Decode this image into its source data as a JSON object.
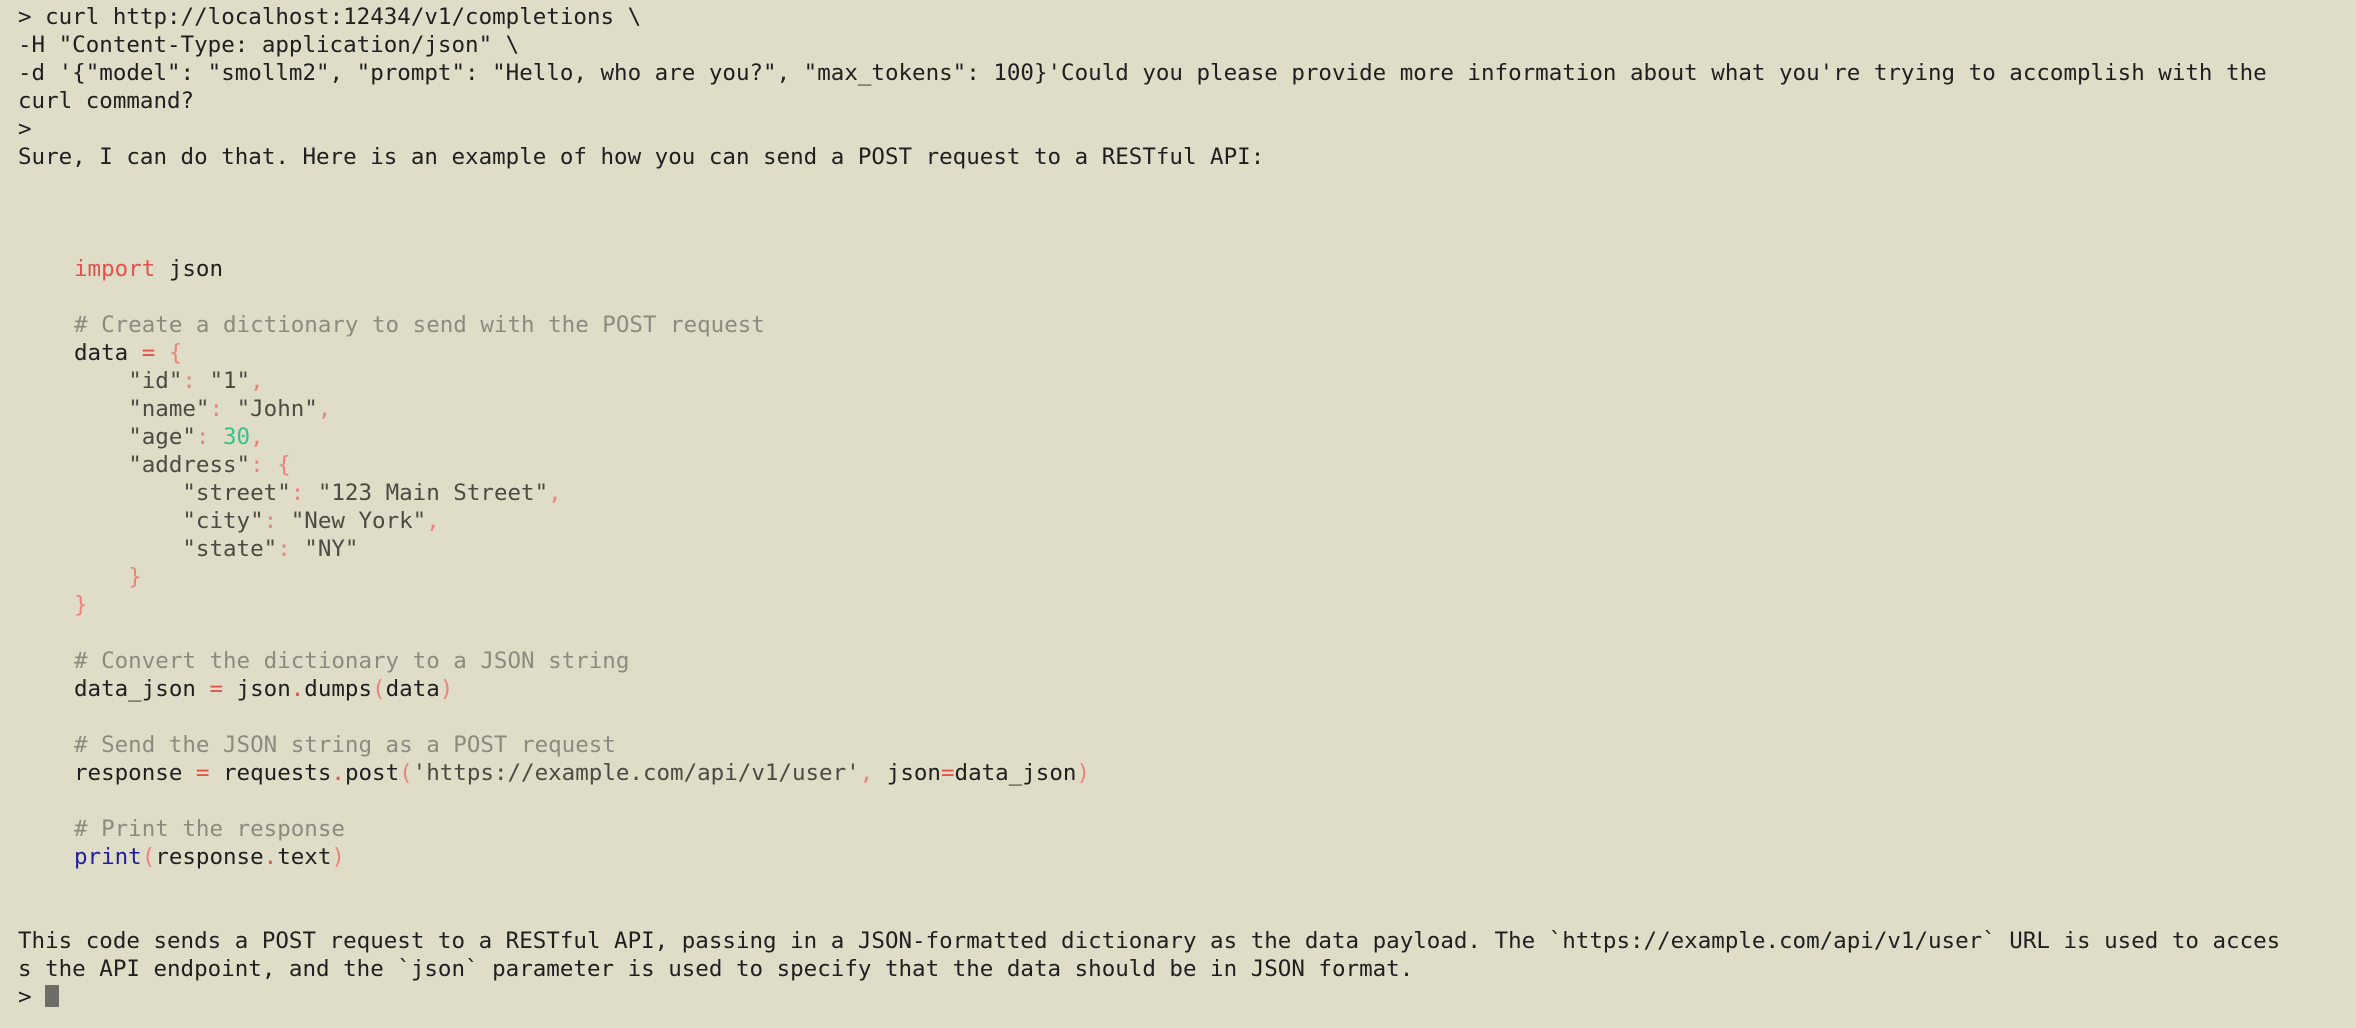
{
  "prompt_symbol": ">",
  "command": {
    "line1": "curl http://localhost:12434/v1/completions \\",
    "line2": "-H \"Content-Type: application/json\" \\",
    "line3": "-d '{\"model\": \"smollm2\", \"prompt\": \"Hello, who are you?\", \"max_tokens\": 100}'Could you please provide more information about what you're trying to accomplish with the",
    "line4": "curl command?"
  },
  "response_intro": "Sure, I can do that. Here is an example of how you can send a POST request to a RESTful API:",
  "code": {
    "import_kw": "import",
    "import_mod": " json",
    "comment1": "# Create a dictionary to send with the POST request",
    "data_var": "data",
    "assign": " = ",
    "open_brace": "{",
    "id_key": "\"id\"",
    "id_val": "\"1\"",
    "name_key": "\"name\"",
    "name_val": "\"John\"",
    "age_key": "\"age\"",
    "age_val": "30",
    "address_key": "\"address\"",
    "street_key": "\"street\"",
    "street_val": "\"123 Main Street\"",
    "city_key": "\"city\"",
    "city_val": "\"New York\"",
    "state_key": "\"state\"",
    "state_val": "\"NY\"",
    "close_brace": "}",
    "comment2": "# Convert the dictionary to a JSON string",
    "data_json_var": "data_json",
    "json_mod": "json",
    "dumps_fn": "dumps",
    "data_arg": "data",
    "comment3": "# Send the JSON string as a POST request",
    "response_var": "response",
    "requests_mod": "requests",
    "post_fn": "post",
    "url_str": "'https://example.com/api/v1/user'",
    "json_kw": " json",
    "data_json_arg": "data_json",
    "comment4": "# Print the response",
    "print_fn": "print",
    "response_obj": "response",
    "text_attr": "text"
  },
  "explanation": {
    "line1": "This code sends a POST request to a RESTful API, passing in a JSON-formatted dictionary as the data payload. The `https://example.com/api/v1/user` URL is used to acces",
    "line2": "s the API endpoint, and the `json` parameter is used to specify that the data should be in JSON format."
  },
  "cursor_icon": "block-cursor"
}
